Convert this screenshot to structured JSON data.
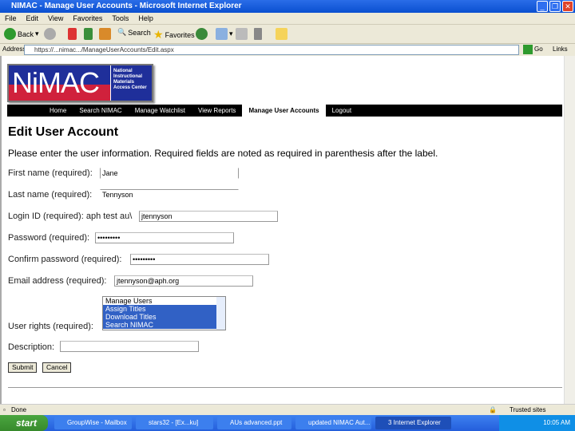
{
  "window": {
    "title": "NIMAC - Manage User Accounts - Microsoft Internet Explorer"
  },
  "menu": [
    "File",
    "Edit",
    "View",
    "Favorites",
    "Tools",
    "Help"
  ],
  "toolbar": {
    "back": "Back",
    "search": "Search",
    "favorites": "Favorites"
  },
  "address": {
    "label": "Address",
    "url": "https://...nimac.../ManageUserAccounts/Edit.aspx",
    "go": "Go",
    "links": "Links"
  },
  "logo": {
    "text": "NiMAC",
    "side": "National Instructional Materials Access Center"
  },
  "nav": [
    "Home",
    "Search NIMAC",
    "Manage Watchlist",
    "View Reports",
    "Manage User Accounts",
    "Logout"
  ],
  "page": {
    "title": "Edit User Account",
    "intro": "Please enter the user information. Required fields are noted as required in parenthesis after the label."
  },
  "form": {
    "first_name_label": "First name (required):",
    "first_name": "Jane",
    "last_name_label": "Last name (required):",
    "last_name": "Tennyson",
    "login_label": "Login ID (required):",
    "login_prefix": "aph test au\\",
    "login": "jtennyson",
    "password_label": "Password (required):",
    "password": "•••••••••",
    "confirm_label": "Confirm password (required):",
    "confirm": "•••••••••",
    "email_label": "Email address (required):",
    "email": "jtennyson@aph.org",
    "rights_label": "User rights (required):",
    "rights": [
      {
        "label": "Manage Users",
        "selected": false
      },
      {
        "label": "Assign Titles",
        "selected": true
      },
      {
        "label": "Download Titles",
        "selected": true
      },
      {
        "label": "Search NIMAC",
        "selected": true
      }
    ],
    "description_label": "Description:",
    "description": "",
    "submit": "Submit",
    "cancel": "Cancel"
  },
  "status": {
    "text": "Done",
    "zone": "Trusted sites"
  },
  "taskbar": {
    "start": "start",
    "tasks": [
      "GroupWise - Mailbox",
      "stars32 - [Ex...ku]",
      "AUs advanced.ppt",
      "updated NIMAC Aut...",
      "3 Internet Explorer"
    ],
    "clock": "10:05 AM"
  }
}
